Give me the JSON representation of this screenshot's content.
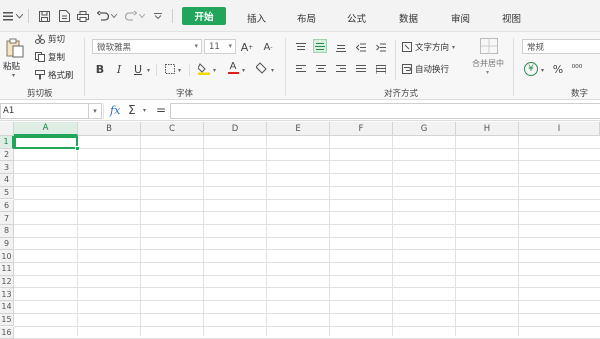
{
  "menu": {
    "tabs": [
      "开始",
      "插入",
      "布局",
      "公式",
      "数据",
      "审阅",
      "视图"
    ]
  },
  "ribbon": {
    "clipboard": {
      "paste_label": "粘贴",
      "cut_label": "剪切",
      "copy_label": "复制",
      "format_painter_label": "格式刷",
      "group_label": "剪切板"
    },
    "font": {
      "font_name": "微软雅黑",
      "font_size": "11",
      "bold": "B",
      "italic": "I",
      "underline": "U",
      "group_label": "字体"
    },
    "alignment": {
      "text_direction_label": "文字方向",
      "wrap_text_label": "自动换行",
      "merge_center_label": "合并居中",
      "group_label": "对齐方式"
    },
    "number": {
      "format_value": "常规",
      "percent": "%",
      "group_label": "数字"
    }
  },
  "formula_bar": {
    "name_box": "A1",
    "fx": "fx",
    "sigma": "Σ",
    "equals": "=",
    "value": ""
  },
  "sheet": {
    "columns": [
      "A",
      "B",
      "C",
      "D",
      "E",
      "F",
      "G",
      "H",
      "I"
    ],
    "rows": [
      "1",
      "2",
      "3",
      "4",
      "5",
      "6",
      "7",
      "8",
      "9",
      "10",
      "11",
      "12",
      "13",
      "14",
      "15",
      "16"
    ],
    "active_cell": "A1"
  },
  "colors": {
    "accent": "#21a55b"
  }
}
